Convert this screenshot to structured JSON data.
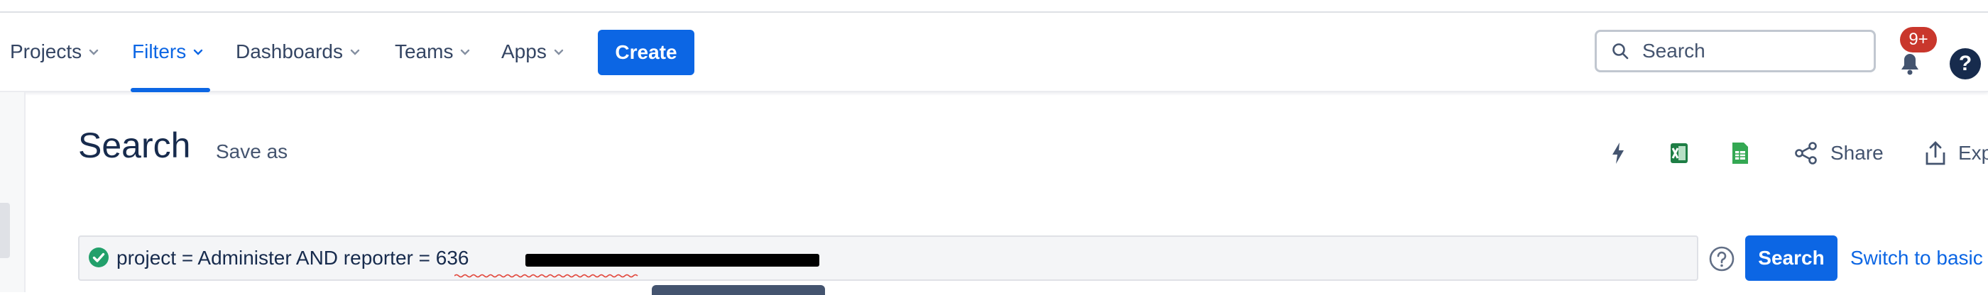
{
  "nav": {
    "items": [
      {
        "label": "Projects"
      },
      {
        "label": "Filters"
      },
      {
        "label": "Dashboards"
      },
      {
        "label": "Teams"
      },
      {
        "label": "Apps"
      }
    ],
    "active": "Filters",
    "create_label": "Create",
    "search_placeholder": "Search",
    "notification_count": "9+",
    "help_label": "?"
  },
  "page": {
    "title": "Search",
    "save_as_label": "Save as",
    "actions": {
      "share_label": "Share",
      "export_label": "Exp"
    }
  },
  "jql": {
    "query": "project = Administer AND reporter = 636",
    "search_button_label": "Search",
    "switch_label": "Switch to basic"
  },
  "colors": {
    "primary": "#0c66e4",
    "badge": "#c9372c",
    "valid": "#22a06b",
    "excel": "#1e7e45",
    "sheets": "#34a853"
  }
}
